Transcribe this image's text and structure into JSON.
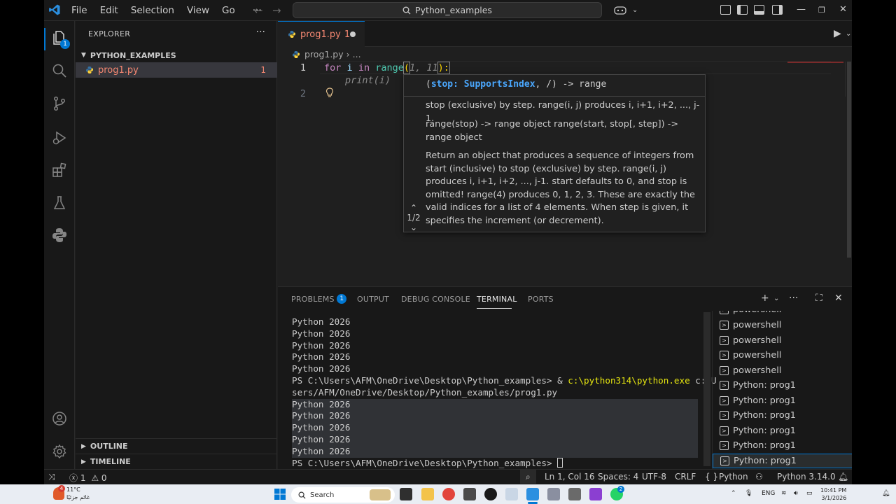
{
  "titlebar": {
    "menu": [
      "File",
      "Edit",
      "Selection",
      "View",
      "Go"
    ],
    "more": "···",
    "search": "Python_examples"
  },
  "activity": {
    "explorer_badge": "1"
  },
  "sidebar": {
    "header": "EXPLORER",
    "folder": "PYTHON_EXAMPLES",
    "file": {
      "name": "prog1.py",
      "problems": "1"
    },
    "sections": [
      "OUTLINE",
      "TIMELINE"
    ]
  },
  "editor": {
    "tab": {
      "label": "prog1.py",
      "problems": "1"
    },
    "breadcrumb": {
      "file": "prog1.py",
      "rest": "..."
    },
    "line_numbers": [
      "1",
      "2"
    ],
    "code": {
      "kw_for": "for",
      "var_i": "i",
      "kw_in": "in",
      "fn_range": "range",
      "args_open": "(",
      "arg1": "1",
      "comma": ", ",
      "arg2": "11",
      "args_close": "):",
      "ghost_line": "print(i)"
    }
  },
  "signature_help": {
    "signature_param": "stop: SupportsIndex",
    "signature_rest": ", /) -> range",
    "signature_open": "(",
    "doc1": "stop (exclusive) by step. range(i, j) produces i, i+1, i+2, ..., j-1.",
    "doc2": "range(stop) -> range object range(start, stop[, step]) -> range object",
    "doc3": "Return an object that produces a sequence of integers from start (inclusive) to stop (exclusive) by step. range(i, j) produces i, i+1, i+2, ..., j-1. start defaults to 0, and stop is omitted! range(4) produces 0, 1, 2, 3. These are exactly the valid indices for a list of 4 elements. When step is given, it specifies the increment (or decrement).",
    "pager": "1/2"
  },
  "panel": {
    "tabs": [
      "PROBLEMS",
      "OUTPUT",
      "DEBUG CONSOLE",
      "TERMINAL",
      "PORTS"
    ],
    "problems_count": "1",
    "terminal_lines_before": [
      "Python 2026",
      "Python 2026",
      "Python 2026",
      "Python 2026",
      "Python 2026"
    ],
    "prompt": "PS C:\\Users\\AFM\\OneDrive\\Desktop\\Python_examples> ",
    "command_amp": "& ",
    "command_exe": "c:\\python314\\python.exe",
    "command_arg_1": " c:/U",
    "command_arg_2": "sers/AFM/OneDrive/Desktop/Python_examples/prog1.py",
    "terminal_lines_after": [
      "Python 2026",
      "Python 2026",
      "Python 2026",
      "Python 2026",
      "Python 2026"
    ],
    "final_prompt": "PS C:\\Users\\AFM\\OneDrive\\Desktop\\Python_examples> ",
    "terminal_list": [
      "powershell",
      "powershell",
      "powershell",
      "powershell",
      "powershell",
      "Python: prog1",
      "Python: prog1",
      "Python: prog1",
      "Python: prog1",
      "Python: prog1",
      "Python: prog1"
    ]
  },
  "statusbar": {
    "errors": "1",
    "warnings": "0",
    "position": "Ln 1, Col 16",
    "spaces": "Spaces: 4",
    "encoding": "UTF-8",
    "eol": "CRLF",
    "language_braces": "{ }",
    "language": "Python",
    "interpreter": "Python 3.14.0"
  },
  "taskbar": {
    "weather_temp": "11°C",
    "weather_desc": "غائم جزئيًا",
    "weather_badge": "4",
    "search": "Search",
    "lang": "ENG",
    "time": "10:41 PM",
    "date": "3/1/2026",
    "whatsapp_badge": "2"
  },
  "colors": {
    "accent": "#0078d4",
    "error": "#f48771",
    "keyword": "#c586c0",
    "variable": "#9cdcfe",
    "function": "#4ec9b0",
    "param": "#4aa8ff",
    "terminal_yellow": "#e5e510"
  }
}
